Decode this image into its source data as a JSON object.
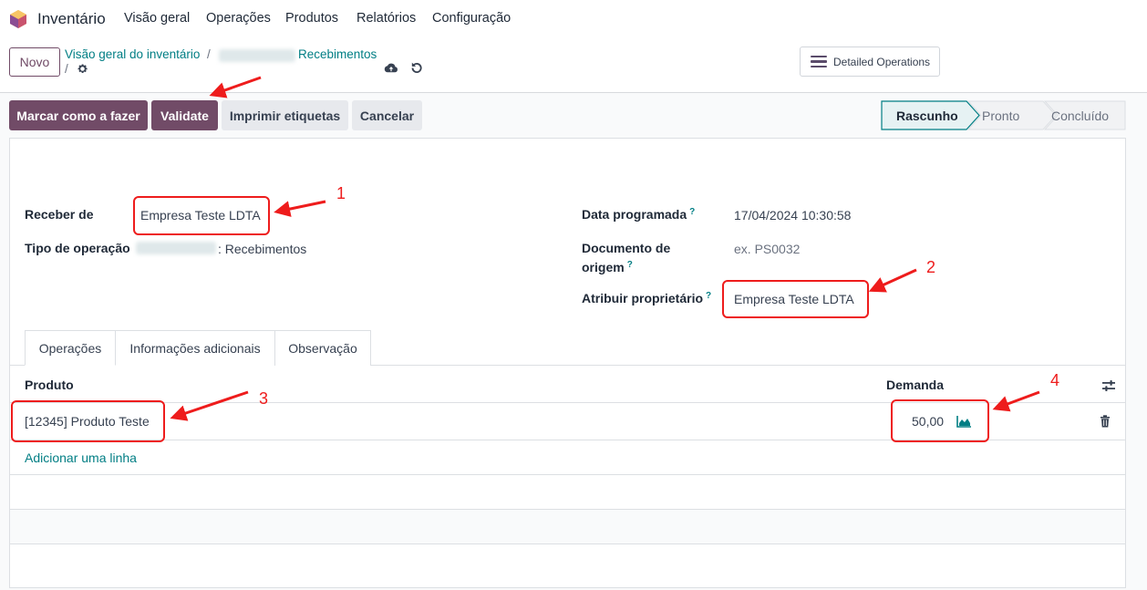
{
  "topnav": {
    "app_name": "Inventário",
    "menu": [
      "Visão geral",
      "Operações",
      "Produtos",
      "Relatórios",
      "Configuração"
    ]
  },
  "control_panel": {
    "new_button": "Novo",
    "breadcrumb_root": "Visão geral do inventário",
    "breadcrumb_current": "Recebimentos",
    "breadcrumb_sep": "/",
    "detailed_operations": "Detailed Operations"
  },
  "actions": {
    "mark_todo": "Marcar como a fazer",
    "validate": "Validate",
    "print_labels": "Imprimir etiquetas",
    "cancel": "Cancelar"
  },
  "statusbar": {
    "states": [
      "Rascunho",
      "Pronto",
      "Concluído"
    ],
    "active_index": 0
  },
  "form": {
    "receive_from_label": "Receber de",
    "receive_from_value": "Empresa Teste LDTA",
    "operation_type_label": "Tipo de operação",
    "operation_type_value": ": Recebimentos",
    "scheduled_date_label": "Data programada",
    "scheduled_date_value": "17/04/2024 10:30:58",
    "source_doc_label_1": "Documento de",
    "source_doc_label_2": "origem",
    "source_doc_placeholder": "ex. PS0032",
    "owner_label": "Atribuir proprietário",
    "owner_value": "Empresa Teste LDTA",
    "help_mark": "?"
  },
  "tabs": [
    "Operações",
    "Informações adicionais",
    "Observação"
  ],
  "table": {
    "col_product": "Produto",
    "col_demand": "Demanda",
    "rows": [
      {
        "product": "[12345] Produto Teste",
        "demand": "50,00"
      }
    ],
    "add_line": "Adicionar uma linha"
  },
  "annotations": [
    "1",
    "2",
    "3",
    "4"
  ],
  "colors": {
    "brand": "#714b67",
    "link": "#017e84",
    "annotation": "#ee1c1c"
  }
}
